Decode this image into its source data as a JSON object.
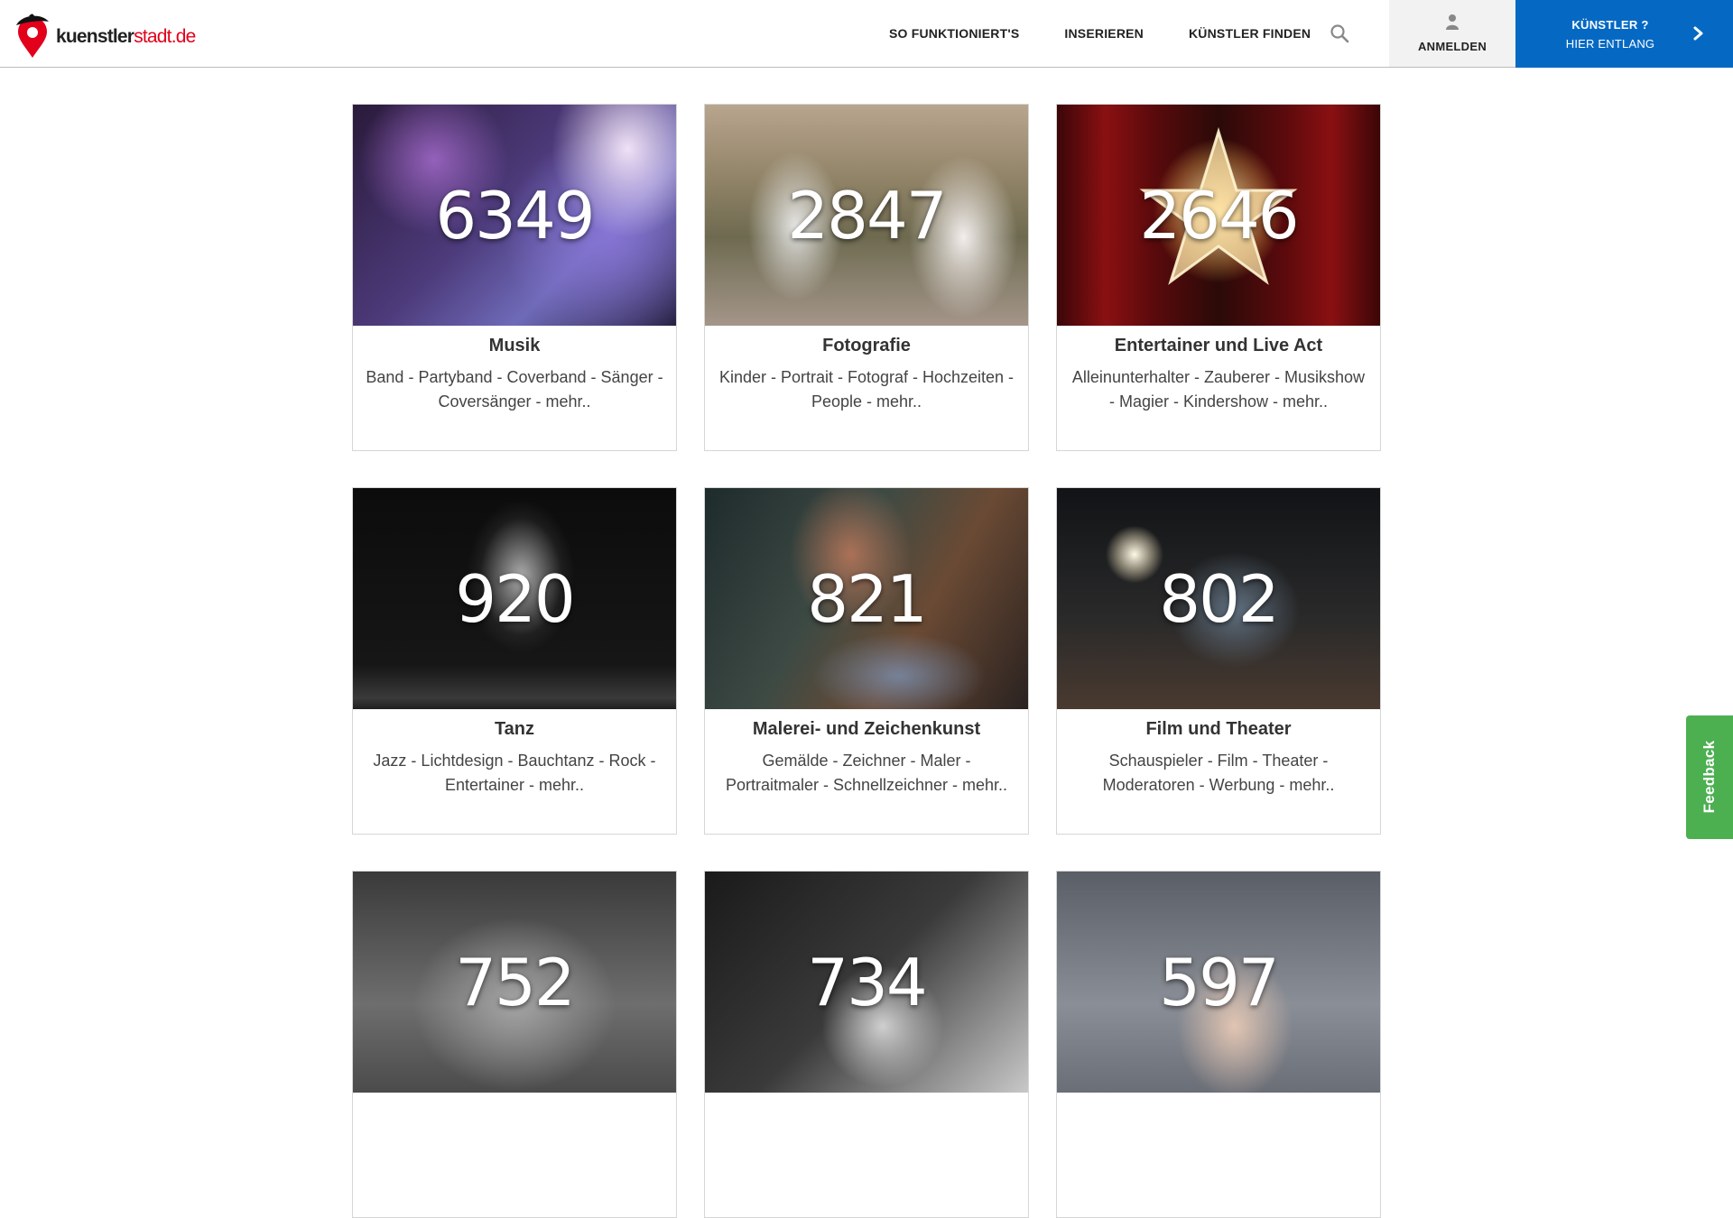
{
  "header": {
    "logo": {
      "text_main": "kuenstler",
      "text_accent": "stadt.de"
    },
    "nav": [
      {
        "label": "SO FUNKTIONIERT'S"
      },
      {
        "label": "INSERIEREN"
      },
      {
        "label": "KÜNSTLER FINDEN"
      }
    ],
    "login_label": "ANMELDEN",
    "cta": {
      "line1": "KÜNSTLER ?",
      "line2": "HIER ENTLANG"
    },
    "icons": {
      "search": "search-icon",
      "user": "user-icon",
      "chevron": "chevron-right-icon"
    }
  },
  "colors": {
    "brand_blue": "#0569c4",
    "brand_red": "#e2001a",
    "feedback_green": "#4caf50"
  },
  "categories": [
    {
      "count": "6349",
      "title": "Musik",
      "desc": "Band - Partyband - Coverband - Sänger - Coversänger - mehr.."
    },
    {
      "count": "2847",
      "title": "Fotografie",
      "desc": "Kinder - Portrait - Fotograf - Hochzeiten - People - mehr.."
    },
    {
      "count": "2646",
      "title": "Entertainer und Live Act",
      "desc": "Alleinunterhalter - Zauberer - Musikshow - Magier - Kindershow - mehr.."
    },
    {
      "count": "920",
      "title": "Tanz",
      "desc": "Jazz - Lichtdesign - Bauchtanz - Rock - Entertainer - mehr.."
    },
    {
      "count": "821",
      "title": "Malerei- und Zeichenkunst",
      "desc": "Gemälde - Zeichner - Maler - Portraitmaler - Schnellzeichner - mehr.."
    },
    {
      "count": "802",
      "title": "Film und Theater",
      "desc": "Schauspieler - Film - Theater - Moderatoren - Werbung - mehr.."
    },
    {
      "count": "752",
      "title": "",
      "desc": ""
    },
    {
      "count": "734",
      "title": "",
      "desc": ""
    },
    {
      "count": "597",
      "title": "",
      "desc": ""
    }
  ],
  "feedback_label": "Feedback"
}
